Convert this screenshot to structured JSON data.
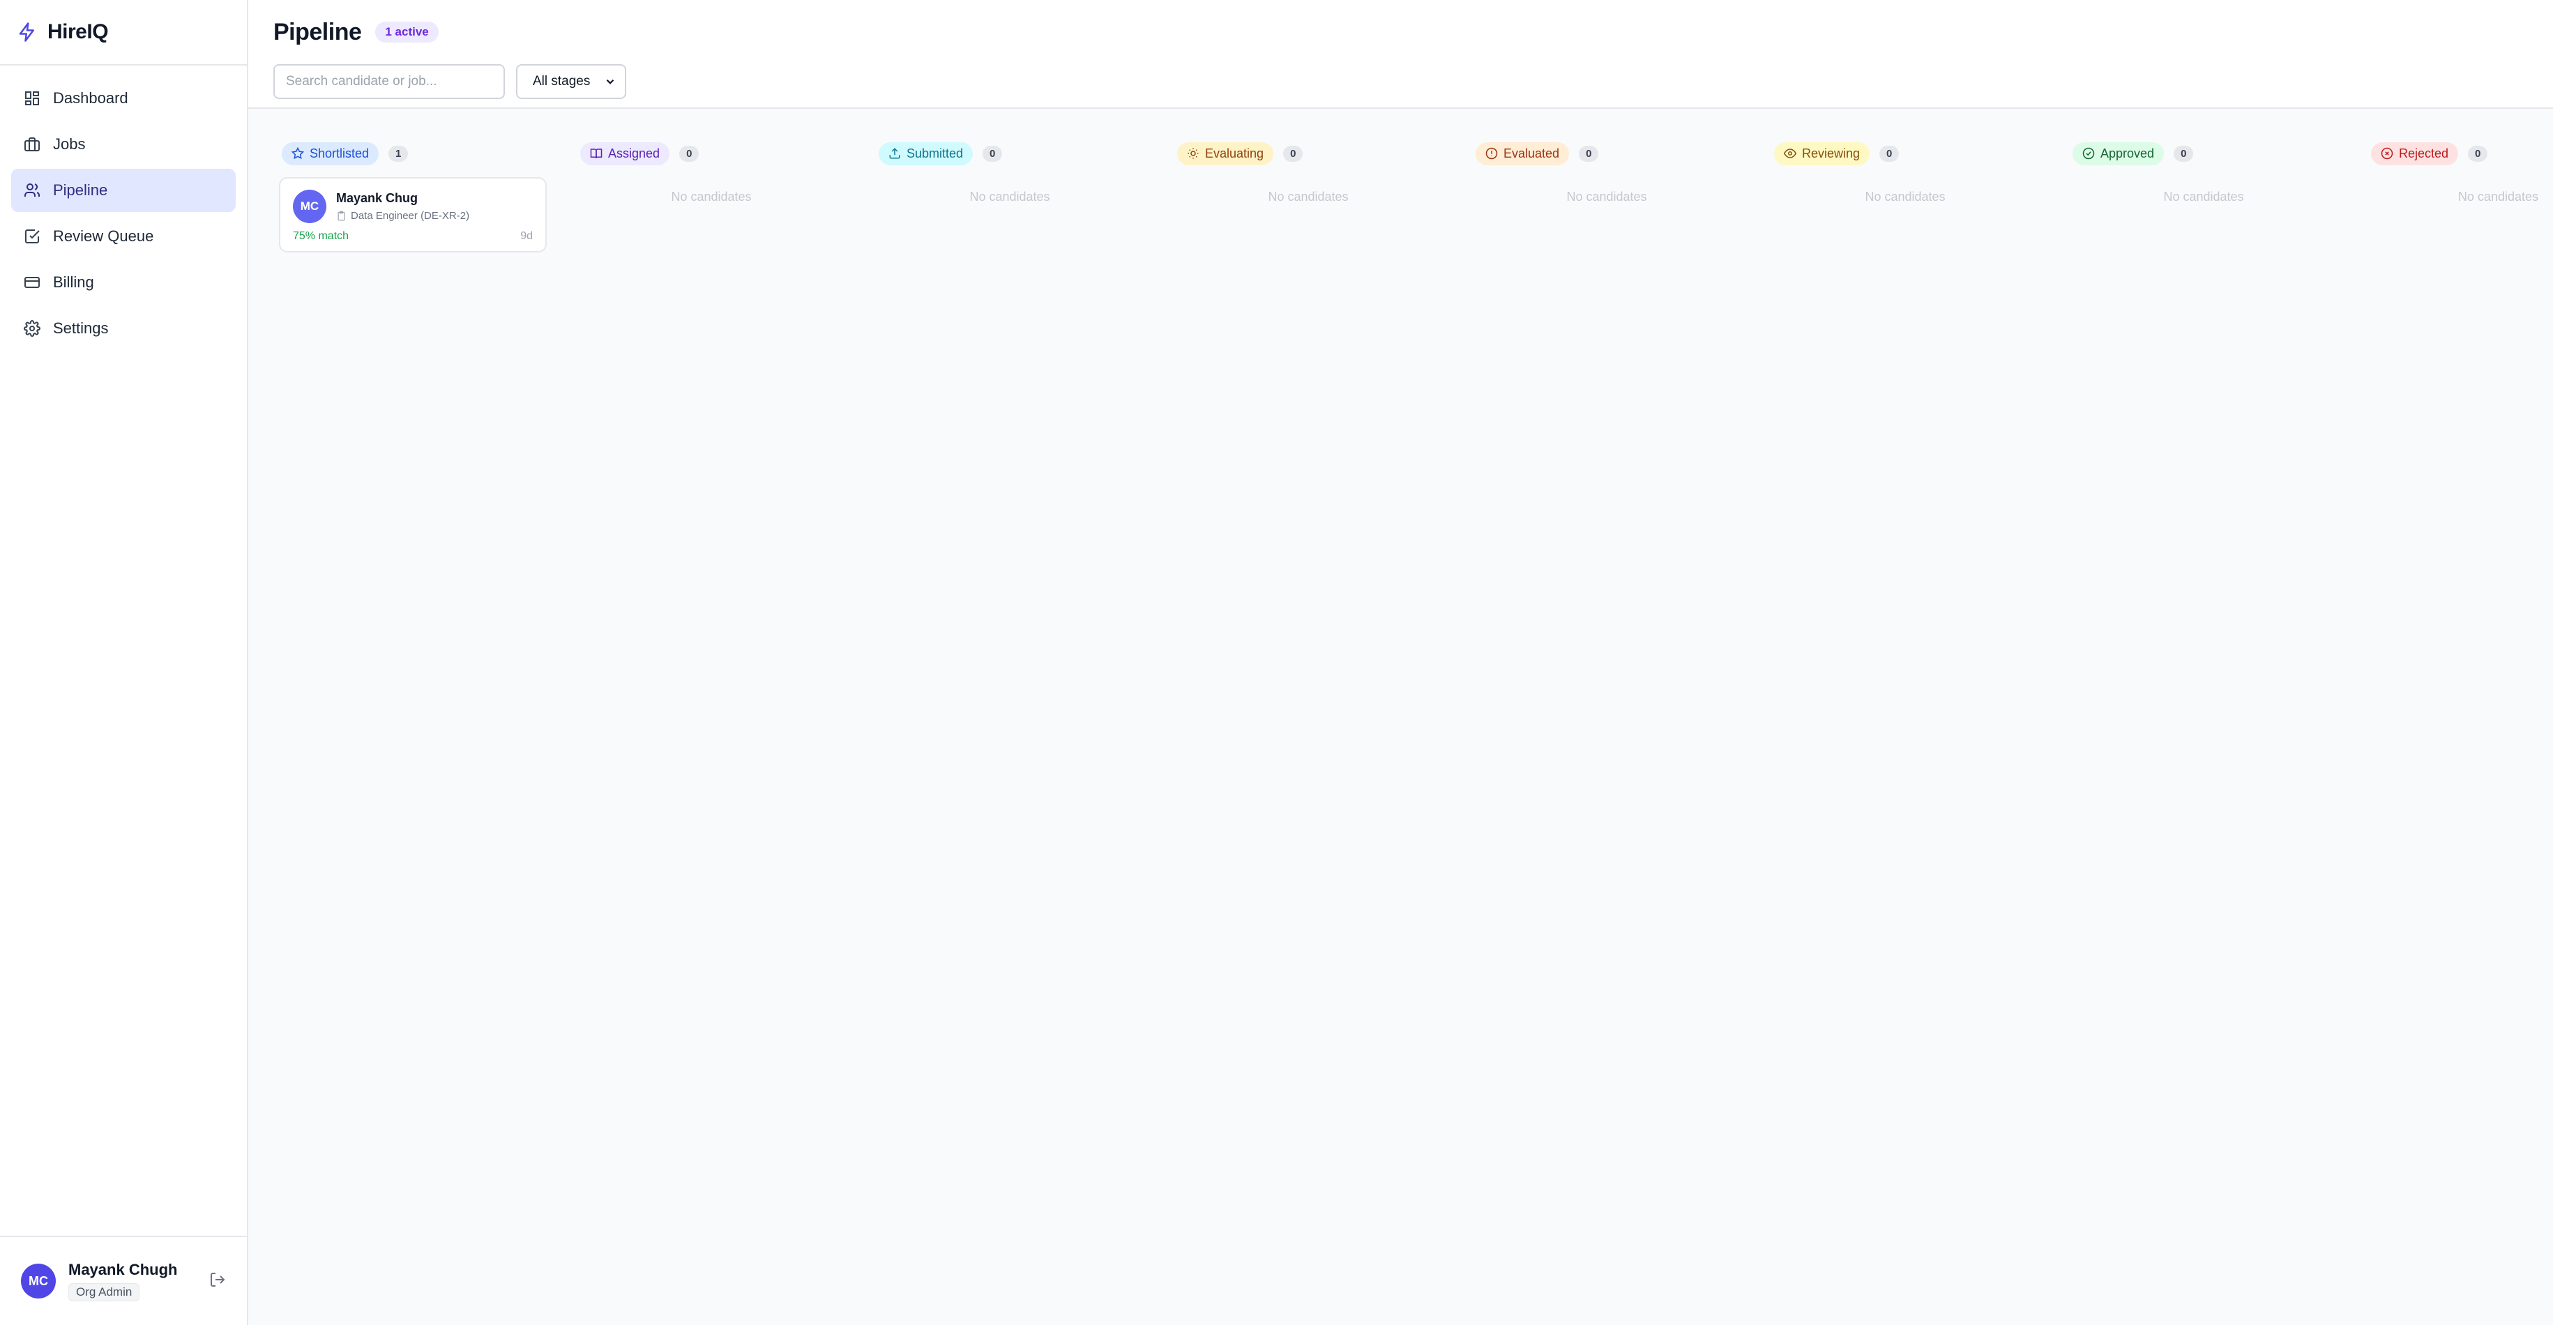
{
  "app": {
    "name": "HireIQ"
  },
  "nav": {
    "items": [
      {
        "label": "Dashboard",
        "icon": "dashboard-icon"
      },
      {
        "label": "Jobs",
        "icon": "briefcase-icon"
      },
      {
        "label": "Pipeline",
        "icon": "users-icon",
        "active": true
      },
      {
        "label": "Review Queue",
        "icon": "checkbox-icon"
      },
      {
        "label": "Billing",
        "icon": "credit-card-icon"
      },
      {
        "label": "Settings",
        "icon": "gear-icon"
      }
    ]
  },
  "user": {
    "initials": "MC",
    "name": "Mayank Chugh",
    "role": "Org Admin"
  },
  "header": {
    "title": "Pipeline",
    "badge": "1 active",
    "search_placeholder": "Search candidate or job...",
    "stage_filter": "All stages"
  },
  "empty_text": "No candidates",
  "stages": [
    {
      "label": "Shortlisted",
      "count": "1",
      "icon": "star-icon",
      "bg": "#dbeafe",
      "fg": "#1d4ed8"
    },
    {
      "label": "Assigned",
      "count": "0",
      "icon": "book-icon",
      "bg": "#ede9fe",
      "fg": "#5b21b6"
    },
    {
      "label": "Submitted",
      "count": "0",
      "icon": "upload-icon",
      "bg": "#cffafe",
      "fg": "#0e7490"
    },
    {
      "label": "Evaluating",
      "count": "0",
      "icon": "sun-icon",
      "bg": "#fef3c7",
      "fg": "#92400e"
    },
    {
      "label": "Evaluated",
      "count": "0",
      "icon": "alert-circle-icon",
      "bg": "#ffedd5",
      "fg": "#9a3412"
    },
    {
      "label": "Reviewing",
      "count": "0",
      "icon": "eye-icon",
      "bg": "#fef9c3",
      "fg": "#854d0e"
    },
    {
      "label": "Approved",
      "count": "0",
      "icon": "check-circle-icon",
      "bg": "#dcfce7",
      "fg": "#166534"
    },
    {
      "label": "Rejected",
      "count": "0",
      "icon": "x-circle-icon",
      "bg": "#fee2e2",
      "fg": "#b91c1c"
    }
  ],
  "candidate": {
    "initials": "MC",
    "name": "Mayank Chug",
    "job": "Data Engineer (DE-XR-2)",
    "match": "75% match",
    "age": "9d"
  }
}
